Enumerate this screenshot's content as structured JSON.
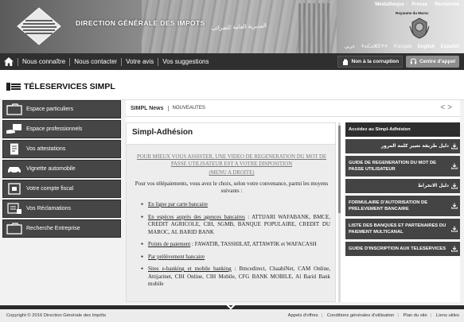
{
  "header": {
    "title": "DIRECTION GÉNÉRALE DES IMPOTS",
    "title_arabic": "المديرية العامة للضرائب",
    "royaume": "Royaume du Maroc",
    "top_links": [
      "Médiathèque",
      "Presse",
      "Recherche"
    ],
    "languages": [
      "عربي",
      "ⵜⴰⵎⴰⵣⵉⵖⵜ",
      "Français",
      "English",
      "Español"
    ],
    "selected_language": "English"
  },
  "nav": {
    "items": [
      "Nous connaître",
      "Nous contacter",
      "Votre avis",
      "Vos suggestions"
    ],
    "corruption": "Non à la corruption",
    "call_center": "Centre d'appel"
  },
  "teleservices": {
    "title": "TÉLESERVICES SIMPL"
  },
  "sidebar": {
    "items": [
      {
        "label": "Espace particuliers",
        "icon": "folder-icon"
      },
      {
        "label": "Espace professionnels",
        "icon": "hand-card-icon"
      },
      {
        "label": "Vos attestations",
        "icon": "document-icon"
      },
      {
        "label": "Vignette automobile",
        "icon": "car-icon"
      },
      {
        "label": "Votre compte fiscal",
        "icon": "account-icon"
      },
      {
        "label": "Vos Réclamations",
        "icon": "complaint-icon"
      },
      {
        "label": "Recherche Entreprise",
        "icon": "folder-search-icon"
      }
    ]
  },
  "news": {
    "label": "SIMPL News",
    "tag": "NOUVEAUTES",
    "prev": "<",
    "next": ">"
  },
  "adhesion": {
    "title": "Simpl-Adhésion",
    "video_link": "POUR MIEUX VOUS ASSISTER, UNE VIDEO DE REGENERATION DU MOT DE PASSE UTILISATEUR EST A VOTRE DISPOSITION",
    "menu_link": "(MENU A DROITE)",
    "intro": "Pour vos télépaiements, vous avez le choix, selon votre convenance, parmi les moyens suivants :",
    "options": [
      {
        "link": "En ligne par carte bancaire",
        "rest": ""
      },
      {
        "link": "En espèces auprès des agences bancaires",
        "rest": " : ATTIJARI WAFABANK, BMCE, CREDIT AGRICOLE, CIH, SGMB, BANQUE POPULAIRE, CREDIT DU MAROC, AL BARID BANK"
      },
      {
        "link": "Points de paiement",
        "rest": " : FAWATIR, TASSHILAT, ATTAWFIK et WAFACASH"
      },
      {
        "link": "Par prélèvement bancaire",
        "rest": ""
      },
      {
        "link": "Sites e-banking et mobile banking",
        "rest": " : Bmcedirect, ChaabiNet, CAM Online, Attijarinet, CIH Online, CIH Mobile, CFG BANK MOBILE, Al Barid Bank mobile"
      }
    ]
  },
  "links_panel": {
    "header": "Accédez au Simpl-Adhésion",
    "items": [
      "دليل طريقة تغيير كلمة المرور",
      "GUIDE DE REGENERATION DU MOT DE PASSE UTILISATEUR",
      "دليل الانخراط",
      "FORMULAIRE D'AUTORISATION DE PRELEVEMENT BANCAIRE",
      "LISTE DES BANQUES ET PARTENAIRES DU PAIEMENT MULTICANAL",
      "GUIDE D'INSCRIPTION AUX TELESERVICES"
    ]
  },
  "footer": {
    "copyright": "Copyright © 2016 Direction Générale des Impôts",
    "links": [
      "Appels d'offres",
      "Conditions générales d'utilisation",
      "Plan du site",
      "Liens utiles"
    ]
  },
  "colors": {
    "nav_bg": "#2f2f2f",
    "sidebar_bg": "#464646",
    "panel_item_bg": "#444444"
  }
}
